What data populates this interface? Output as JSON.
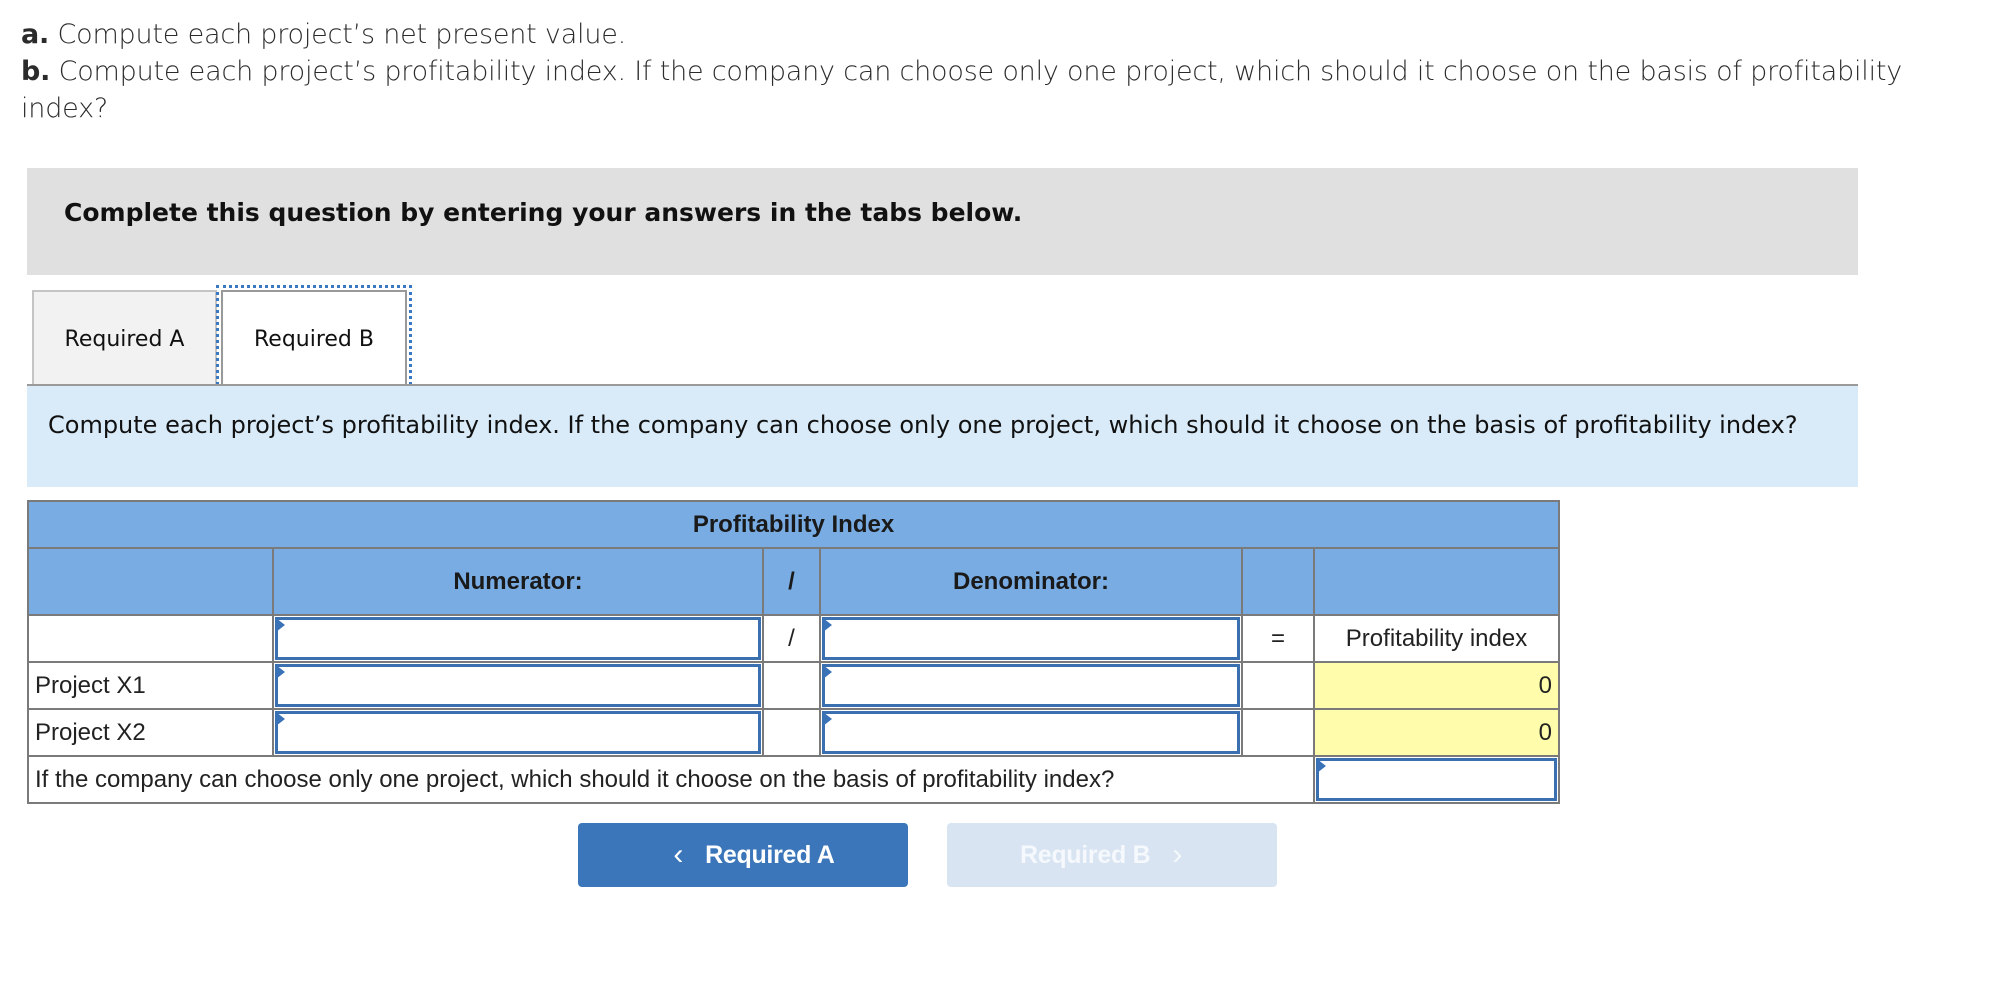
{
  "question": {
    "a_prefix": "a.",
    "a_text": "Compute each project’s net present value.",
    "b_prefix": "b.",
    "b_text": "Compute each project’s profitability index. If the company can choose only one project, which should it choose on the basis of profitability index?"
  },
  "instructions": "Complete this question by entering your answers in the tabs below.",
  "tabs": [
    {
      "label": "Required A",
      "active": false
    },
    {
      "label": "Required B",
      "active": true
    }
  ],
  "prompt": "Compute each project’s profitability index. If the company can choose only one project, which should it choose on the basis of profitability index?",
  "table": {
    "title": "Profitability Index",
    "headers": {
      "numerator": "Numerator:",
      "slash": "/",
      "denominator": "Denominator:",
      "equals": "",
      "result": ""
    },
    "formula_row": {
      "label": "",
      "numerator": "",
      "slash": "/",
      "denominator": "",
      "equals": "=",
      "result": "Profitability index"
    },
    "rows": [
      {
        "label": "Project X1",
        "numerator": "",
        "denominator": "",
        "result": "0"
      },
      {
        "label": "Project X2",
        "numerator": "",
        "denominator": "",
        "result": "0"
      }
    ],
    "choice_question": "If the company can choose only one project, which should it choose on the basis of profitability index?",
    "choice_value": ""
  },
  "nav": {
    "prev_label": "Required A",
    "next_label": "Required B",
    "prev_icon": "‹",
    "next_icon": "›"
  },
  "colors": {
    "header_blue": "#78ace3",
    "result_yellow": "#fffdab",
    "button_blue": "#3b76ba",
    "button_disabled": "#d8e4f1",
    "prompt_band": "#d9ebf9"
  }
}
